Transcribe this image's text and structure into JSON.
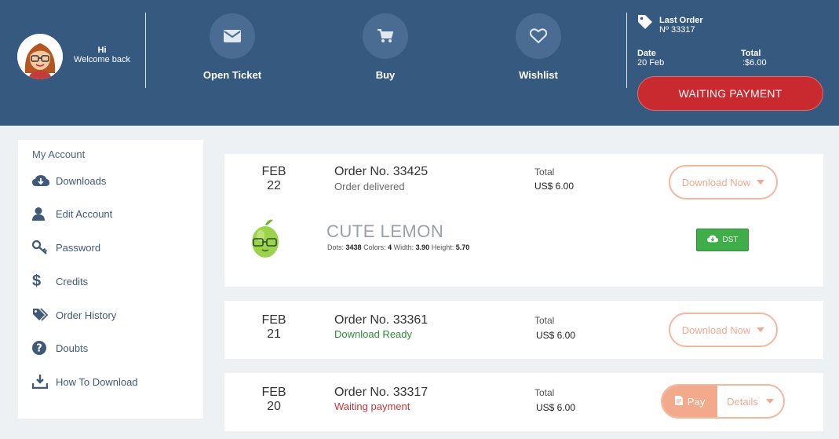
{
  "header": {
    "greeting": "Hi",
    "welcome": "Welcome back",
    "actions": [
      {
        "label": "Open Ticket",
        "icon": "envelope-icon"
      },
      {
        "label": "Buy",
        "icon": "cart-icon"
      },
      {
        "label": "Wishlist",
        "icon": "heart-icon"
      }
    ],
    "last_order": {
      "title": "Last Order",
      "number": "Nº 33317",
      "date_label": "Date",
      "date_value": "20 Feb",
      "total_label": "Total",
      "total_value": ":$6.00"
    },
    "status_button": "WAITING PAYMENT"
  },
  "sidebar": {
    "title": "My Account",
    "items": [
      {
        "label": "Downloads",
        "icon": "cloud-download-icon"
      },
      {
        "label": "Edit Account",
        "icon": "user-icon"
      },
      {
        "label": "Password",
        "icon": "key-icon"
      },
      {
        "label": "Credits",
        "icon": "dollar-icon"
      },
      {
        "label": "Order History",
        "icon": "tags-icon"
      },
      {
        "label": "Doubts",
        "icon": "question-icon"
      },
      {
        "label": "How To Download",
        "icon": "download-tray-icon"
      }
    ]
  },
  "orders": [
    {
      "month": "FEB",
      "day": "22",
      "number": "Order No. 33425",
      "status": "Order delivered",
      "status_color": "#6b6b6b",
      "total_label": "Total",
      "total_value": "US$ 6.00",
      "action": "Download Now",
      "product": {
        "name": "CUTE LEMON",
        "dots_label": "Dots:",
        "dots": "3438",
        "colors_label": "Colors:",
        "colors": "4",
        "width_label": "Width:",
        "width": "3.90",
        "height_label": "Height:",
        "height": "5.70",
        "file_button": "DST"
      }
    },
    {
      "month": "FEB",
      "day": "21",
      "number": "Order No. 33361",
      "status": "Download Ready",
      "status_color": "#2e8b3a",
      "total_label": "Total",
      "total_value": "US$ 6.00",
      "action": "Download Now"
    },
    {
      "month": "FEB",
      "day": "20",
      "number": "Order No. 33317",
      "status": "Waiting payment",
      "status_color": "#c8343a",
      "total_label": "Total",
      "total_value": "US$ 6.00",
      "pay_label": "Pay",
      "details_label": "Details"
    }
  ],
  "colors": {
    "header_bg": "#36597f",
    "accent_red": "#c82a2f",
    "accent_peach": "#f3a98c",
    "success_green": "#3fae49"
  }
}
